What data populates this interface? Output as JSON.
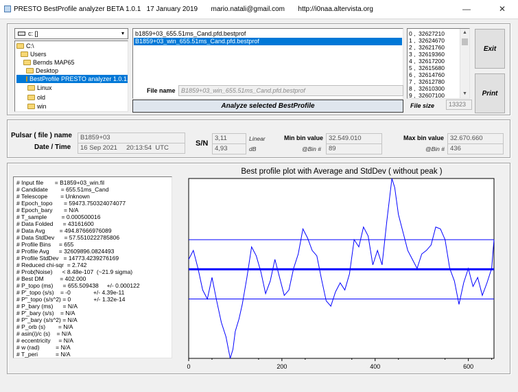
{
  "window": {
    "title": "PRESTO BestProfile analyzer BETA 1.0.1   17 January 2019       mario.natali@gmail.com       http://i0naa.altervista.org",
    "min_glyph": "—",
    "close_glyph": "✕"
  },
  "drive": {
    "label": "c: []",
    "arrow": "▾"
  },
  "folders": [
    {
      "label": "C:\\"
    },
    {
      "label": "Users"
    },
    {
      "label": "Bernds MAP65"
    },
    {
      "label": "Desktop"
    },
    {
      "label": "BestProfile PRESTO analyzer 1.0.1.e"
    },
    {
      "label": "Linux"
    },
    {
      "label": "old"
    },
    {
      "label": "win"
    }
  ],
  "files": [
    {
      "name": "b1859+03_655.51ms_Cand.pfd.bestprof"
    },
    {
      "name": "B1859+03_win_655.51ms_Cand.pfd.bestprof"
    }
  ],
  "filename": {
    "label": "File name",
    "value": "B1859+03_win_655.51ms_Cand.pfd.bestprof"
  },
  "analyze_button": "Analyze selected BestProfile",
  "bins": [
    "0 ,  32627210",
    "1 ,  32624670",
    "2 ,  32621760",
    "3 ,  32619360",
    "4 ,  32617200",
    "5 ,  32615680",
    "6 ,  32614760",
    "7 ,  32612780",
    "8 ,  32610300",
    "9 ,  32607100"
  ],
  "exit_button": "Exit",
  "print_button": "Print",
  "file_size": {
    "label": "File size",
    "value": "13323"
  },
  "pulsar": {
    "name_label": "Pulsar ( file ) name",
    "name_value": "B1859+03",
    "datetime_label": "Date / Time",
    "datetime_value": "16 Sep 2021     20:13:54  UTC"
  },
  "sn": {
    "label": "S/N",
    "linear_value": "3,11",
    "linear_unit": "Linear",
    "db_value": "4,93",
    "db_unit": "dB"
  },
  "min_bin": {
    "label": "Min bin value",
    "value": "32.549.010",
    "bin_label": "@Bin #",
    "bin": "89"
  },
  "max_bin": {
    "label": "Max bin value",
    "value": "32.670.660",
    "bin_label": "@Bin #",
    "bin": "436"
  },
  "params": [
    "# Input file       = B1859+03_win.fil",
    "# Candidate        = 655.51ms_Cand",
    "# Telescope        = Unknown",
    "# Epoch_topo       = 59473.750324074077",
    "# Epoch_bary       = N/A",
    "# T_sample         = 0.000500016",
    "# Data Folded      = 43161600",
    "# Data Avg         = 494.87666976089",
    "# Data StdDev      = 57.5510222785806",
    "# Profile Bins     = 655",
    "# Profile Avg      = 32609896.0824493",
    "# Profile StdDev   = 14773.4239276169",
    "# Reduced chi-sqr  = 2.742",
    "# Prob(Noise)      < 8.48e-107  (~21.9 sigma)",
    "# Best DM          = 402.000",
    "# P_topo (ms)      = 655.509438     +/- 0.000122",
    "# P'_topo (s/s)    = -0              +/- 4.39e-11",
    "# P''_topo (s/s^2) = 0              +/- 1.32e-14",
    "# P_bary (ms)      = N/A",
    "# P'_bary (s/s)    = N/A",
    "# P''_bary (s/s^2) = N/A",
    "# P_orb (s)        = N/A",
    "# asin(i)/c (s)    = N/A",
    "# eccentricity     = N/A",
    "# w (rad)          = N/A",
    "# T_peri           = N/A"
  ],
  "chart_data": {
    "type": "line",
    "title": "Best profile plot with  Average and StdDev ( without peak )",
    "xlabel": "",
    "ylabel": "",
    "xlim": [
      0,
      655
    ],
    "xticks": [
      0,
      200,
      400,
      600
    ],
    "ylim": [
      0,
      1
    ],
    "y_scale": "normalized to plot area (no y tick labels shown)",
    "grid": false,
    "series": [
      {
        "line_color": "#0000ff",
        "x": [
          0,
          10,
          20,
          30,
          40,
          50,
          60,
          70,
          80,
          89,
          95,
          100,
          108,
          115,
          125,
          135,
          145,
          155,
          165,
          175,
          185,
          195,
          205,
          215,
          225,
          235,
          245,
          255,
          265,
          275,
          285,
          295,
          305,
          315,
          325,
          335,
          345,
          355,
          365,
          375,
          385,
          395,
          405,
          415,
          425,
          436,
          442,
          450,
          460,
          470,
          480,
          490,
          500,
          510,
          520,
          530,
          540,
          550,
          560,
          570,
          580,
          590,
          600,
          610,
          620,
          630,
          640,
          650,
          655
        ],
        "y": [
          0.55,
          0.6,
          0.5,
          0.38,
          0.33,
          0.45,
          0.32,
          0.2,
          0.12,
          0.0,
          0.05,
          0.15,
          0.22,
          0.3,
          0.45,
          0.62,
          0.57,
          0.48,
          0.36,
          0.43,
          0.55,
          0.45,
          0.35,
          0.38,
          0.5,
          0.58,
          0.72,
          0.67,
          0.6,
          0.57,
          0.44,
          0.32,
          0.29,
          0.37,
          0.42,
          0.38,
          0.47,
          0.66,
          0.62,
          0.73,
          0.68,
          0.52,
          0.6,
          0.52,
          0.76,
          1.0,
          0.95,
          0.8,
          0.7,
          0.6,
          0.55,
          0.5,
          0.58,
          0.6,
          0.63,
          0.73,
          0.72,
          0.66,
          0.5,
          0.43,
          0.3,
          0.42,
          0.5,
          0.4,
          0.45,
          0.35,
          0.42,
          0.5,
          0.66
        ]
      }
    ],
    "reference_lines": [
      {
        "label": "Average",
        "y": 0.495,
        "line_color": "#0000ff"
      },
      {
        "label": "Average + StdDev",
        "y": 0.66,
        "line_color": "#0000ff"
      },
      {
        "label": "Average - StdDev",
        "y": 0.33,
        "line_color": "#0000ff"
      }
    ]
  }
}
